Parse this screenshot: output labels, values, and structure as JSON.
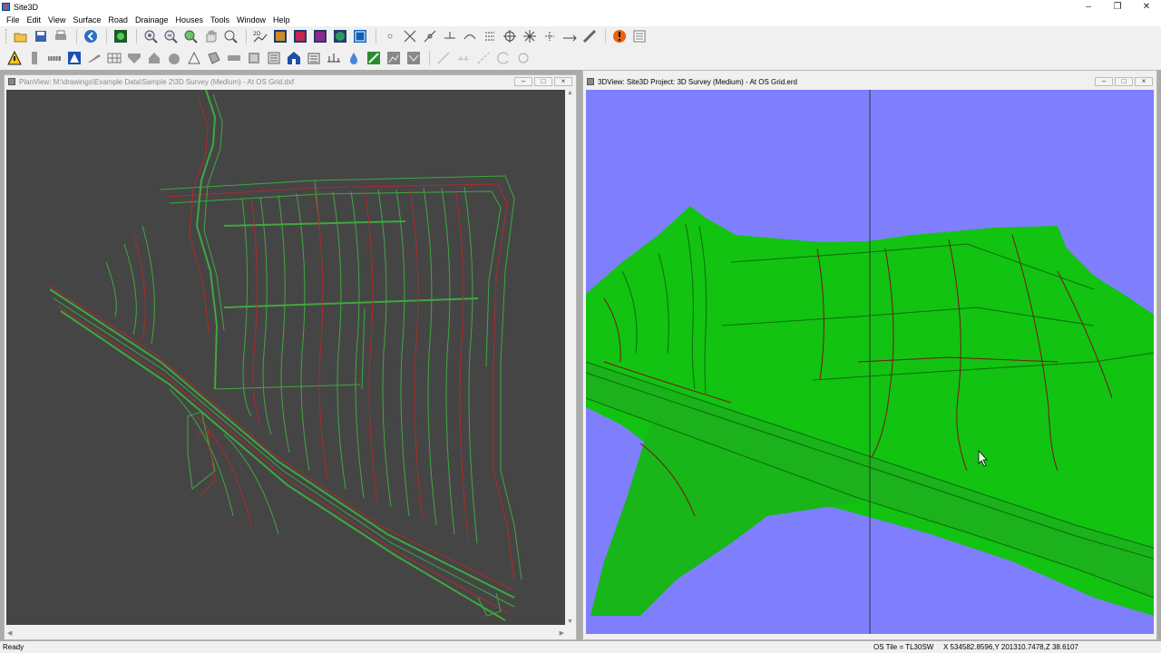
{
  "app": {
    "title": "Site3D"
  },
  "menu": [
    "File",
    "Edit",
    "View",
    "Surface",
    "Road",
    "Drainage",
    "Houses",
    "Tools",
    "Window",
    "Help"
  ],
  "toolbar1": {
    "icons": [
      "open-folder-icon",
      "save-icon",
      "print-icon",
      "back-icon",
      "terrain-icon",
      "zoom-in-icon",
      "zoom-out-icon",
      "zoom-extents-icon",
      "pan-hand-icon",
      "zoom-window-icon",
      "view-2d3d-icon",
      "render-shaded-icon",
      "render-colour-icon",
      "render-texture-icon",
      "render-globe-icon",
      "render-wire-icon",
      "point-icon",
      "intersect-icon",
      "line-icon",
      "bisect-icon",
      "arc-icon",
      "offset-icon",
      "target-icon",
      "move-icon",
      "snap-icon",
      "extend-icon",
      "measure-icon",
      "warning-icon",
      "list-icon"
    ]
  },
  "toolbar2": {
    "icons": [
      "hazard-icon",
      "pipe-icon",
      "culvert-icon",
      "road-sign-icon",
      "ramp-icon",
      "grid-icon",
      "kerb-icon",
      "house-icon",
      "manhole-icon",
      "roof-icon",
      "textures-icon",
      "slab-icon",
      "wall-icon",
      "gully-icon",
      "building-icon",
      "garage-icon",
      "section-icon",
      "drop-icon",
      "green-block-icon",
      "layer-icon",
      "channel-icon",
      "draw-line-icon",
      "dashed-line-icon",
      "dim-line-icon",
      "circle-arc-icon",
      "circle-icon"
    ]
  },
  "plan_view": {
    "title": "PlanView: M:\\drawings\\Example Data\\Sample 2\\3D Survey (Medium) - At OS Grid.dxf"
  },
  "view3d": {
    "title": "3DView: Site3D Project: 3D Survey (Medium) - At OS Grid.erd"
  },
  "status": {
    "ready": "Ready",
    "tile": "OS Tile = TL30SW",
    "coords": "X 534582.8596,Y 201310.7478,Z 38.6107"
  },
  "colors": {
    "plan_bg": "#454545",
    "contour_green": "#3fa83f",
    "contour_red": "#b02a2a",
    "sky": "#7f7ffe",
    "terrain": "#12c312"
  }
}
